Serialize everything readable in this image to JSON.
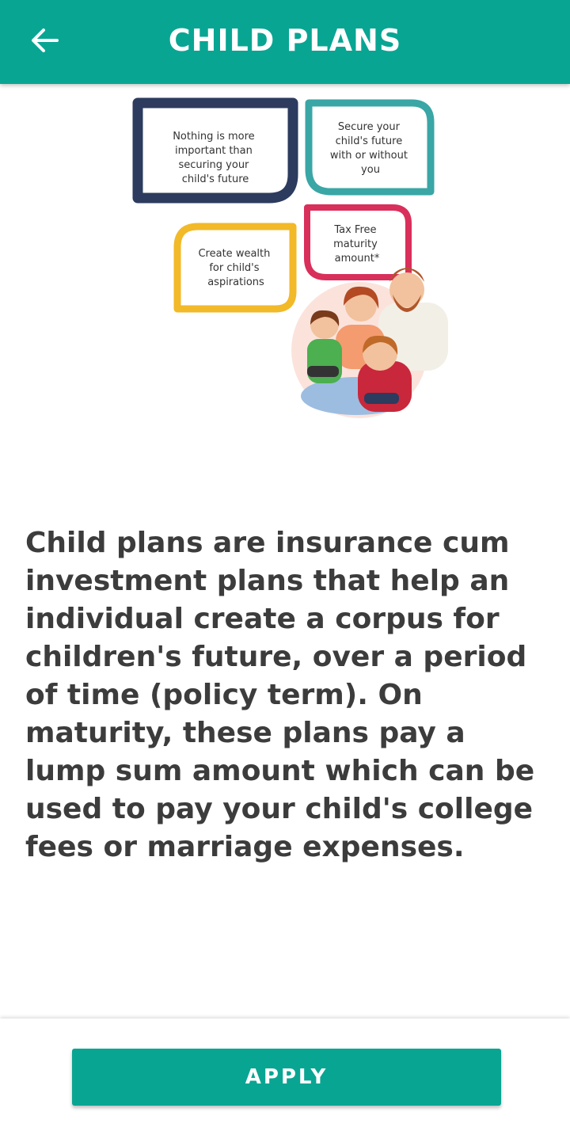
{
  "header": {
    "title": "CHILD PLANS",
    "back_icon": "arrow-left-icon"
  },
  "hero": {
    "bubbles": [
      {
        "text": "Nothing is more important than securing your child's future",
        "color": "#2c3b5e"
      },
      {
        "text": "Secure your child's future with or without you",
        "color": "#3aa6a6"
      },
      {
        "text": "Create wealth for child's aspirations",
        "color": "#f2b928"
      },
      {
        "text": "Tax Free maturity amount*",
        "color": "#d92f5b"
      }
    ]
  },
  "main": {
    "description": "Child plans are insurance cum investment plans that help an individual create a corpus for children's future, over a period of time (policy term). On maturity, these plans pay a lump sum amount which can be used to pay your child's college fees or marriage expenses."
  },
  "footer": {
    "apply_label": "APPLY"
  },
  "colors": {
    "accent": "#09a593",
    "text": "#3c3c3c"
  }
}
